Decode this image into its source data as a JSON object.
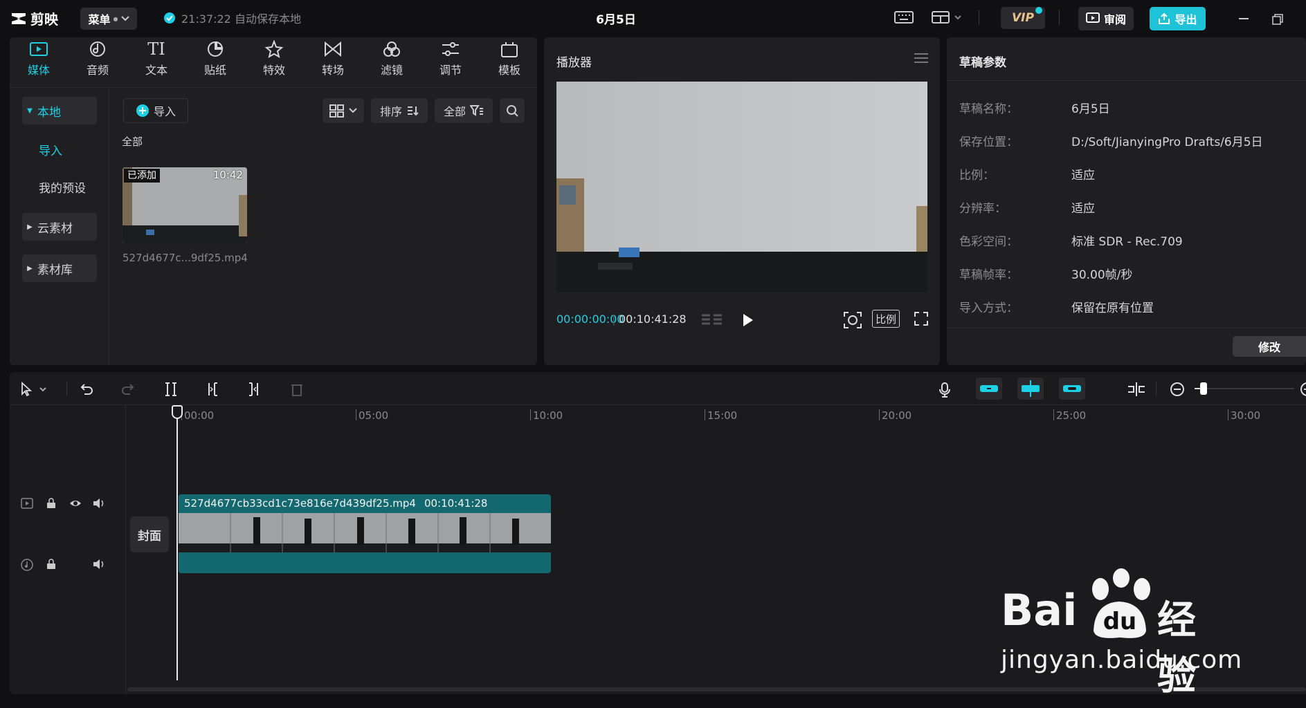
{
  "app": {
    "logo_text": "剪映",
    "menu_label": "菜单",
    "save_status": "21:37:22 自动保存本地",
    "project_title": "6月5日",
    "vip_label": "VIP",
    "review_label": "审阅",
    "export_label": "导出"
  },
  "toolbar_tabs": [
    {
      "label": "媒体",
      "icon": "media-icon"
    },
    {
      "label": "音频",
      "icon": "audio-icon"
    },
    {
      "label": "文本",
      "icon": "text-icon",
      "glyph": "TI"
    },
    {
      "label": "贴纸",
      "icon": "sticker-icon"
    },
    {
      "label": "特效",
      "icon": "effects-icon"
    },
    {
      "label": "转场",
      "icon": "transition-icon"
    },
    {
      "label": "滤镜",
      "icon": "filter-icon"
    },
    {
      "label": "调节",
      "icon": "adjust-icon"
    },
    {
      "label": "模板",
      "icon": "template-icon"
    }
  ],
  "media_sidebar": {
    "local": "本地",
    "import": "导入",
    "my_presets": "我的预设",
    "cloud": "云素材",
    "library": "素材库"
  },
  "media_panel": {
    "import_button": "导入",
    "sort_label": "排序",
    "filter_label": "全部",
    "section_label": "全部",
    "clip": {
      "added_badge": "已添加",
      "duration": "10:42",
      "filename": "527d4677c...9df25.mp4"
    }
  },
  "player": {
    "title": "播放器",
    "current_time": "00:00:00:00",
    "total_time": "00:10:41:28",
    "ratio_label": "比例"
  },
  "params": {
    "title": "草稿参数",
    "rows": [
      {
        "key": "草稿名称：",
        "value": "6月5日"
      },
      {
        "key": "保存位置：",
        "value": "D:/Soft/JianyingPro Drafts/6月5日"
      },
      {
        "key": "比例：",
        "value": "适应"
      },
      {
        "key": "分辨率：",
        "value": "适应"
      },
      {
        "key": "色彩空间：",
        "value": "标准 SDR - Rec.709"
      },
      {
        "key": "草稿帧率：",
        "value": "30.00帧/秒"
      },
      {
        "key": "导入方式：",
        "value": "保留在原有位置"
      }
    ],
    "modify_button": "修改"
  },
  "timeline": {
    "ruler_labels": [
      "00:00",
      "05:00",
      "10:00",
      "15:00",
      "20:00",
      "25:00",
      "30:00"
    ],
    "cover_label": "封面",
    "clip_name": "527d4677cb33cd1c73e816e7d439df25.mp4",
    "clip_duration": "00:10:41:28"
  },
  "watermark": {
    "brand_left": "Bai",
    "brand_right": "经验",
    "url": "jingyan.baidu.com"
  },
  "colors": {
    "accent": "#1ed0e4",
    "panel": "#1f1f22",
    "clip": "#13696f",
    "vip": "#e8c08a"
  }
}
